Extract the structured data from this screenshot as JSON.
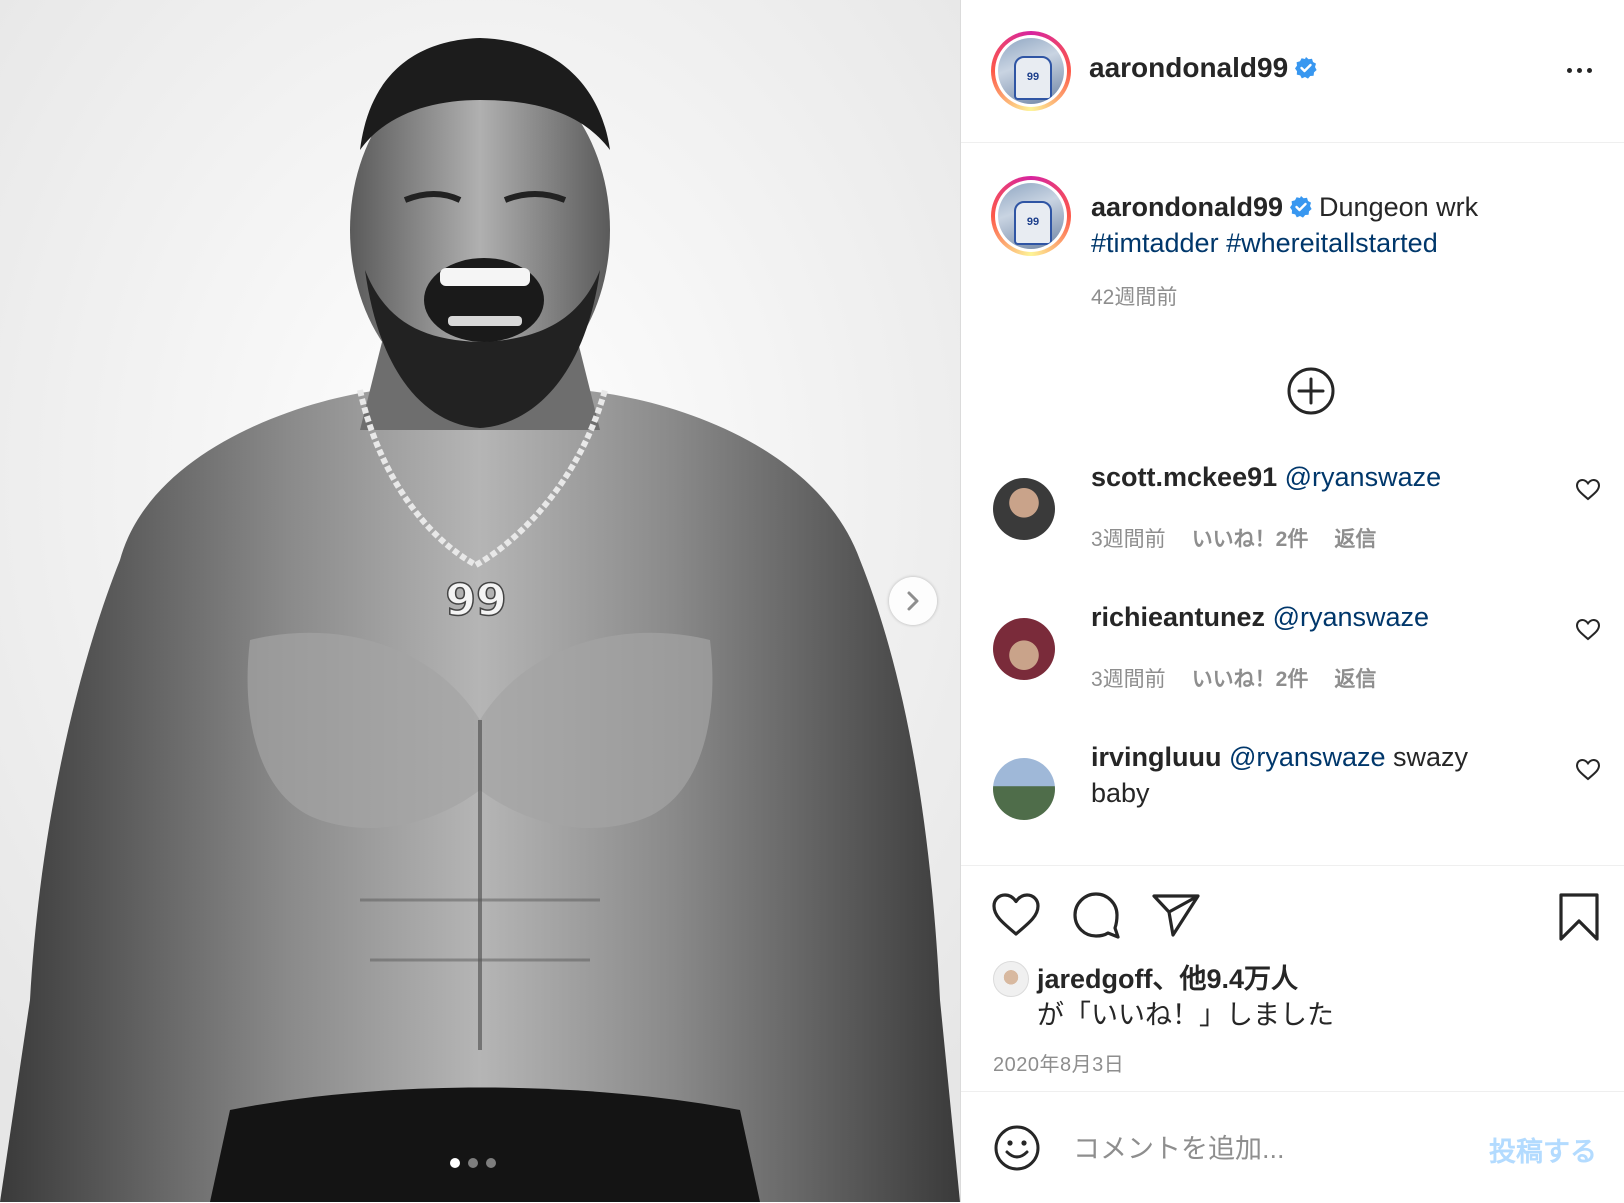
{
  "post": {
    "account": "aarondonald99",
    "caption": {
      "username": "aarondonald99",
      "text": "Dungeon wrk",
      "hashtags": [
        "#timtadder",
        "#whereitallstarted"
      ],
      "time": "42週間前"
    },
    "comments": [
      {
        "username": "scott.mckee91",
        "mention": "@ryanswaze",
        "text": "",
        "time": "3週間前",
        "likes": "いいね！2件",
        "reply": "返信"
      },
      {
        "username": "richieantunez",
        "mention": "@ryanswaze",
        "text": "",
        "time": "3週間前",
        "likes": "いいね！2件",
        "reply": "返信"
      },
      {
        "username": "irvingluuu",
        "mention": "@ryanswaze",
        "text": "swazy baby"
      }
    ],
    "liked_by": {
      "name": "jaredgoff",
      "others": "、他9.4万人",
      "suffix": "が「いいね！」しました"
    },
    "date": "2020年8月3日",
    "add_comment": {
      "placeholder": "コメントを追加...",
      "post_label": "投稿する"
    },
    "media": {
      "jersey_number": "99",
      "slide_count": 3,
      "active_slide": 1
    },
    "icons": {
      "verified": "verified-badge-icon",
      "more": "more-options-icon",
      "next": "chevron-right-icon",
      "load_more": "plus-circle-icon",
      "like": "heart-icon",
      "comment": "comment-bubble-icon",
      "share": "paper-plane-icon",
      "save": "bookmark-icon",
      "emoji": "smiley-icon"
    },
    "colors": {
      "link": "#00376b",
      "verified": "#3897f0",
      "secondary_text": "#8e8e8e",
      "post_button_disabled": "#b3dbff"
    }
  }
}
